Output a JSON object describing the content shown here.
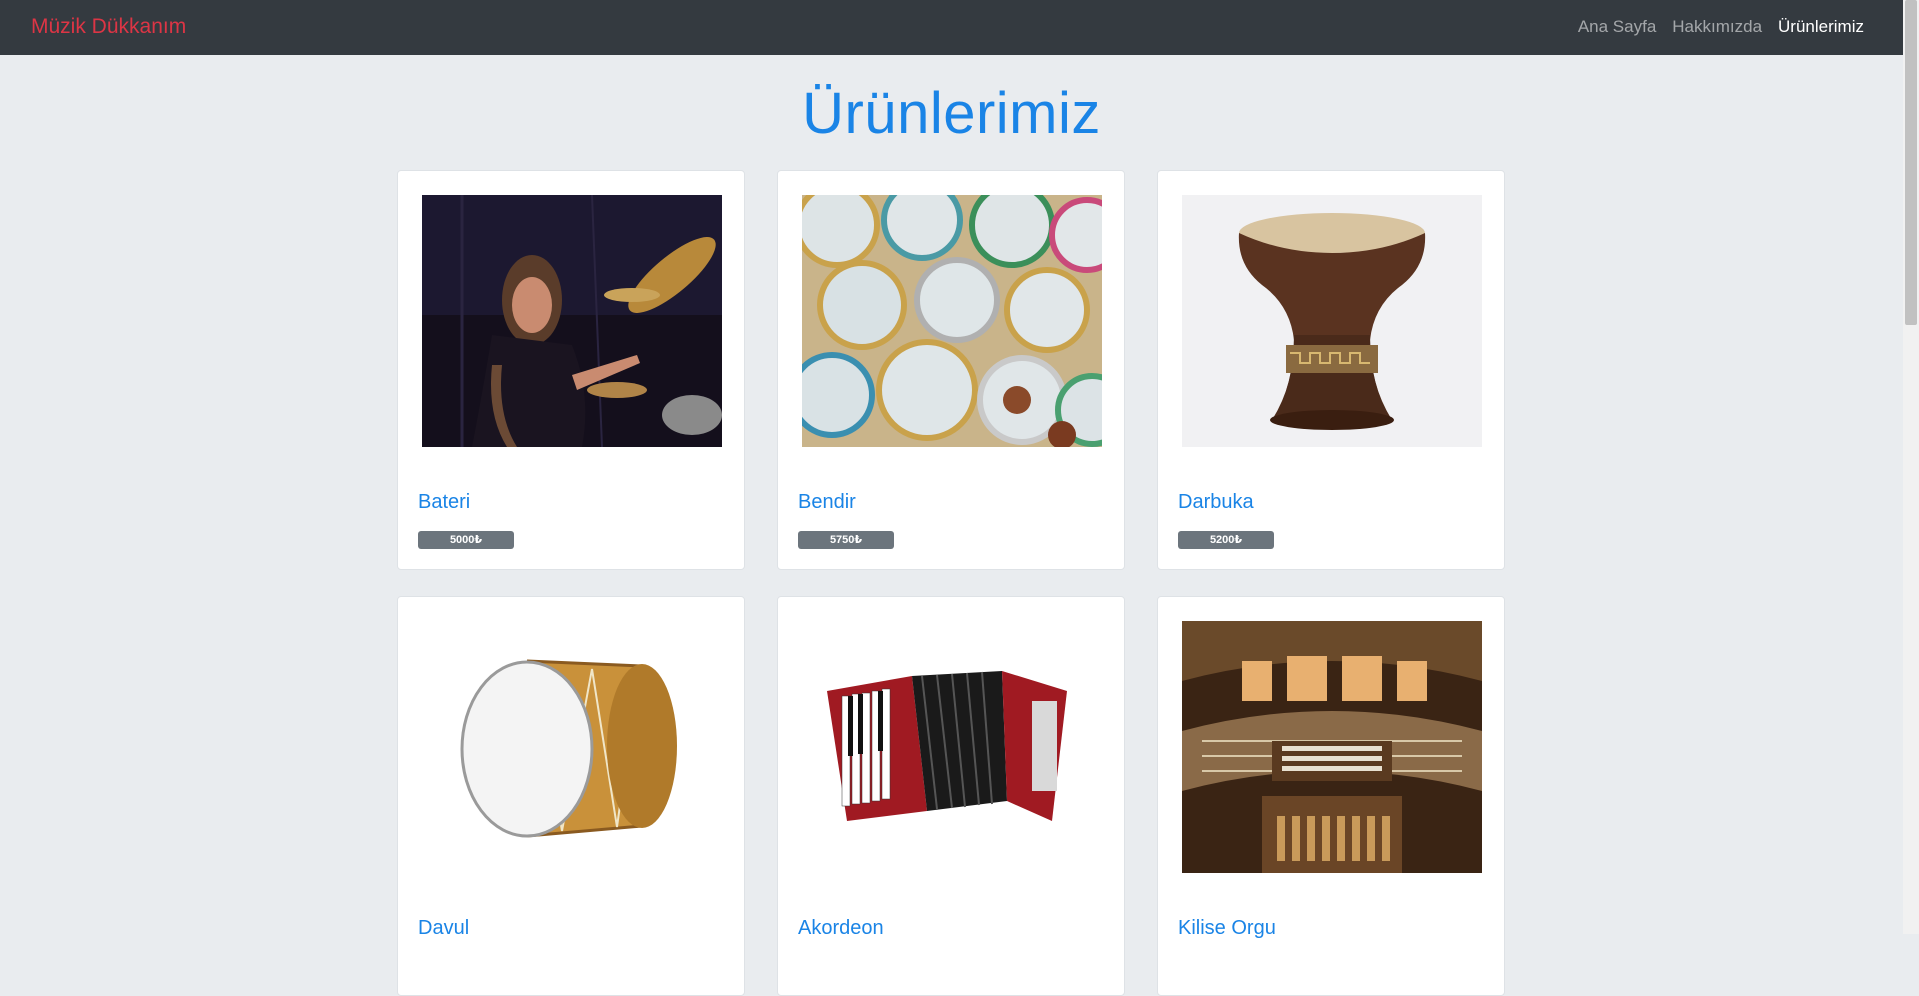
{
  "navbar": {
    "brand": "Müzik Dükkanım",
    "links": [
      {
        "label": "Ana Sayfa",
        "active": false
      },
      {
        "label": "Hakkımızda",
        "active": false
      },
      {
        "label": "Ürünlerimiz",
        "active": true
      }
    ]
  },
  "page": {
    "title": "Ürünlerimiz"
  },
  "products": [
    {
      "name": "Bateri",
      "price": "5000₺",
      "image": "drummer-photo"
    },
    {
      "name": "Bendir",
      "price": "5750₺",
      "image": "bendir-frame-drums-photo"
    },
    {
      "name": "Darbuka",
      "price": "5200₺",
      "image": "darbuka-photo"
    },
    {
      "name": "Davul",
      "price": "",
      "image": "davul-bass-drum-photo"
    },
    {
      "name": "Akordeon",
      "price": "",
      "image": "accordion-photo"
    },
    {
      "name": "Kilise Orgu",
      "price": "",
      "image": "church-organ-photo"
    }
  ],
  "colors": {
    "navbar_bg": "#343a40",
    "brand": "#dc3545",
    "accent": "#1a84e6",
    "page_bg": "#e9ecef",
    "badge_bg": "#6c757d"
  }
}
